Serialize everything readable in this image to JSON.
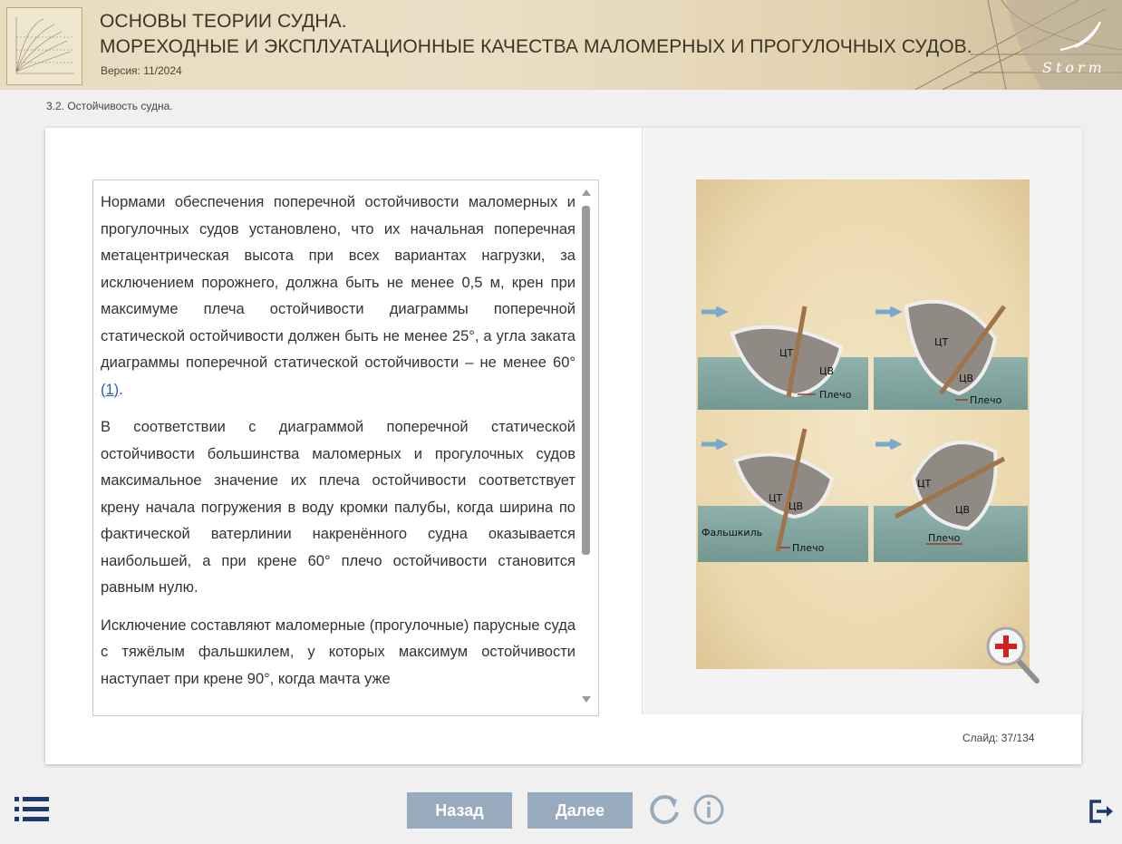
{
  "header": {
    "title_line1": "ОСНОВЫ ТЕОРИИ СУДНА.",
    "title_line2": "МОРЕХОДНЫЕ И ЭКСПЛУАТАЦИОННЫЕ КАЧЕСТВА МАЛОМЕРНЫХ И ПРОГУЛОЧНЫХ СУДОВ.",
    "version": "Версия: 11/2024",
    "brand": "Storm"
  },
  "breadcrumb": "3.2. Остойчивость судна.",
  "content": {
    "p1_text": "Нормами обеспечения поперечной остойчивости маломерных и прогулочных судов установлено, что их начальная поперечная метацентрическая высота при всех вариантах нагрузки, за исключением порожнего, должна быть не менее 0,5 м, крен при максимуме плеча остойчивости диаграммы поперечной статической остойчивости должен быть не менее 25°, а угла заката диаграммы поперечной статической остойчивости – не менее 60° ",
    "p1_ref": "(1)",
    "p1_end": ".",
    "p2": "В соответствии с диаграммой поперечной статической остойчивости большинства маломерных и прогулочных судов максимальное значение их плеча остойчивости соответствует крену начала погружения в воду кромки палубы, когда ширина по фактической ватерлинии накренённого судна оказывается наибольшей, а при крене 60° плечо остойчивости становится равным нулю.",
    "p3": "Исключение составляют маломерные (прогулочные) парусные суда с тяжёлым фальшкилем, у которых максимум остойчивости наступает при крене 90°, когда мачта уже"
  },
  "figure": {
    "label_ct": "ЦТ",
    "label_cv": "ЦВ",
    "label_arm": "Плечо",
    "label_keel": "Фальшкиль"
  },
  "slide": {
    "label": "Слайд:",
    "current": "37",
    "total": "134"
  },
  "nav": {
    "back": "Назад",
    "next": "Далее"
  },
  "icons": {
    "menu": "list-menu-icon",
    "reload": "reload-icon",
    "info": "info-icon",
    "exit": "exit-icon",
    "zoom": "zoom-in-icon"
  },
  "colors": {
    "button": "#97abbd",
    "header_bg": "#e8dcc0",
    "icon_blue": "#1d3a6e"
  }
}
